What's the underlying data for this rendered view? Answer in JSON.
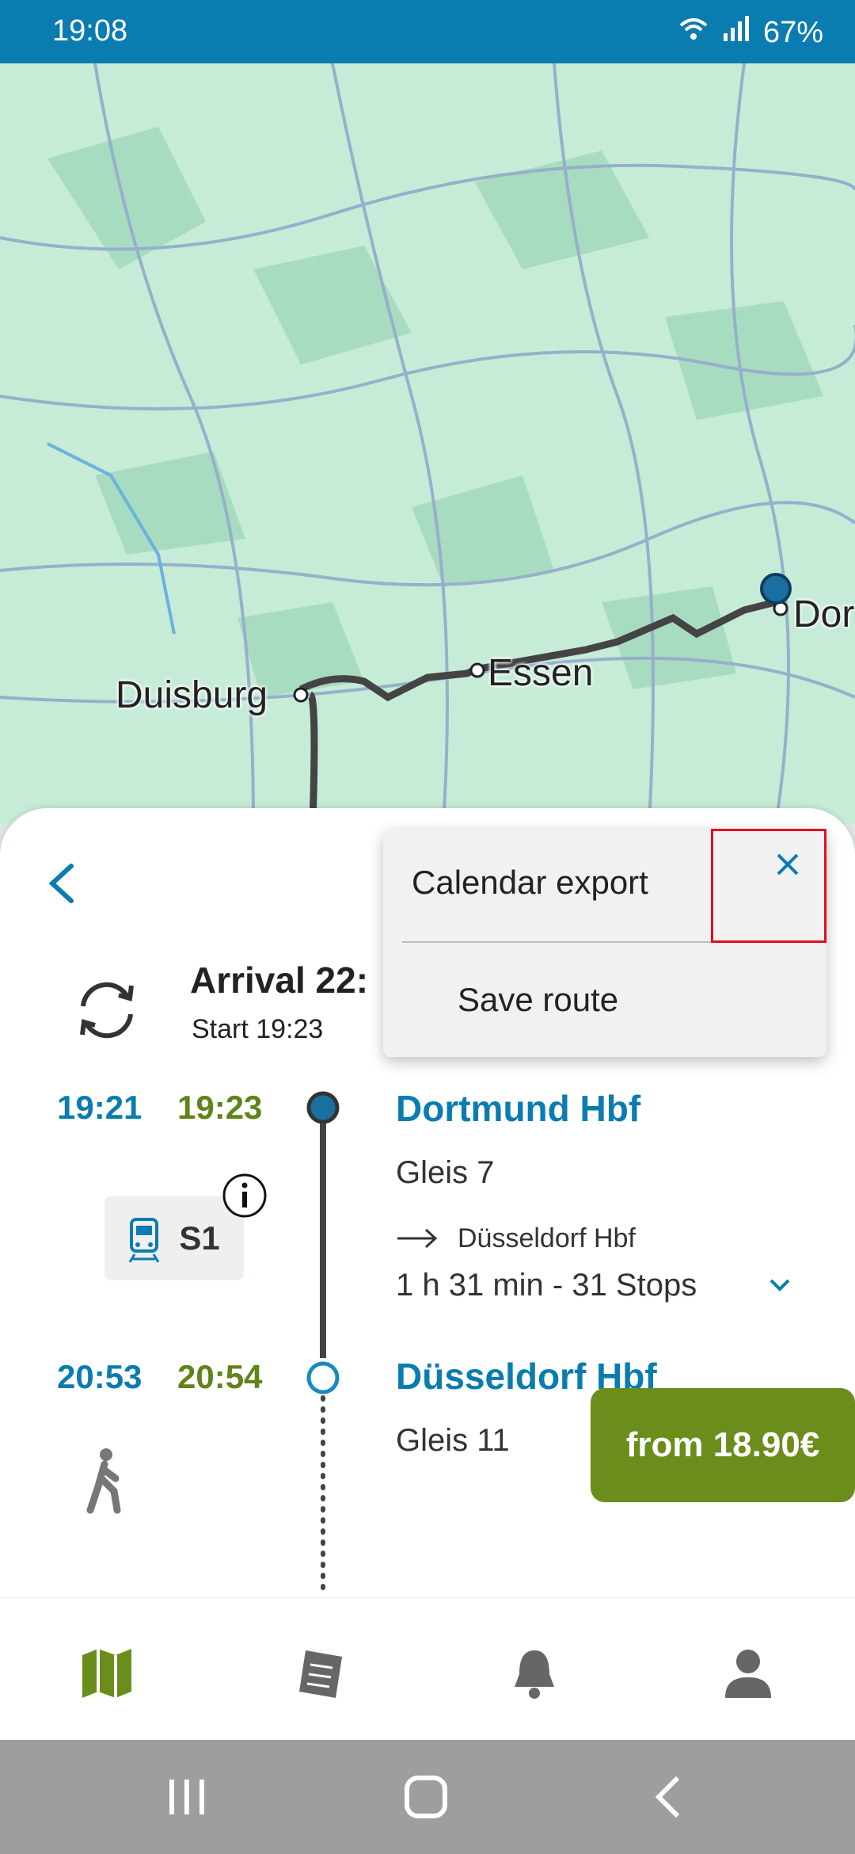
{
  "status": {
    "time": "19:08",
    "battery": "67%"
  },
  "map": {
    "labels": [
      "Duisburg",
      "Essen",
      "Dor"
    ]
  },
  "sheet": {
    "arrival": "Arrival 22:",
    "start": "Start 19:23",
    "stops": [
      {
        "planned": "19:21",
        "actual": "19:23",
        "station": "Dortmund Hbf",
        "platform": "Gleis 7"
      },
      {
        "planned": "20:53",
        "actual": "20:54",
        "station": "Düsseldorf Hbf",
        "platform": "Gleis 11"
      }
    ],
    "line": "S1",
    "direction": "Düsseldorf Hbf",
    "duration": "1 h 31 min - 31 Stops",
    "price": "from 18.90€"
  },
  "menu": {
    "calendar_export": "Calendar export",
    "save_route": "Save route"
  },
  "colors": {
    "primary": "#0a7cb0",
    "green": "#6a8d1b",
    "map_bg": "#c6ecd7"
  },
  "nav": [
    "map-icon",
    "tickets-icon",
    "bell-icon",
    "profile-icon"
  ]
}
